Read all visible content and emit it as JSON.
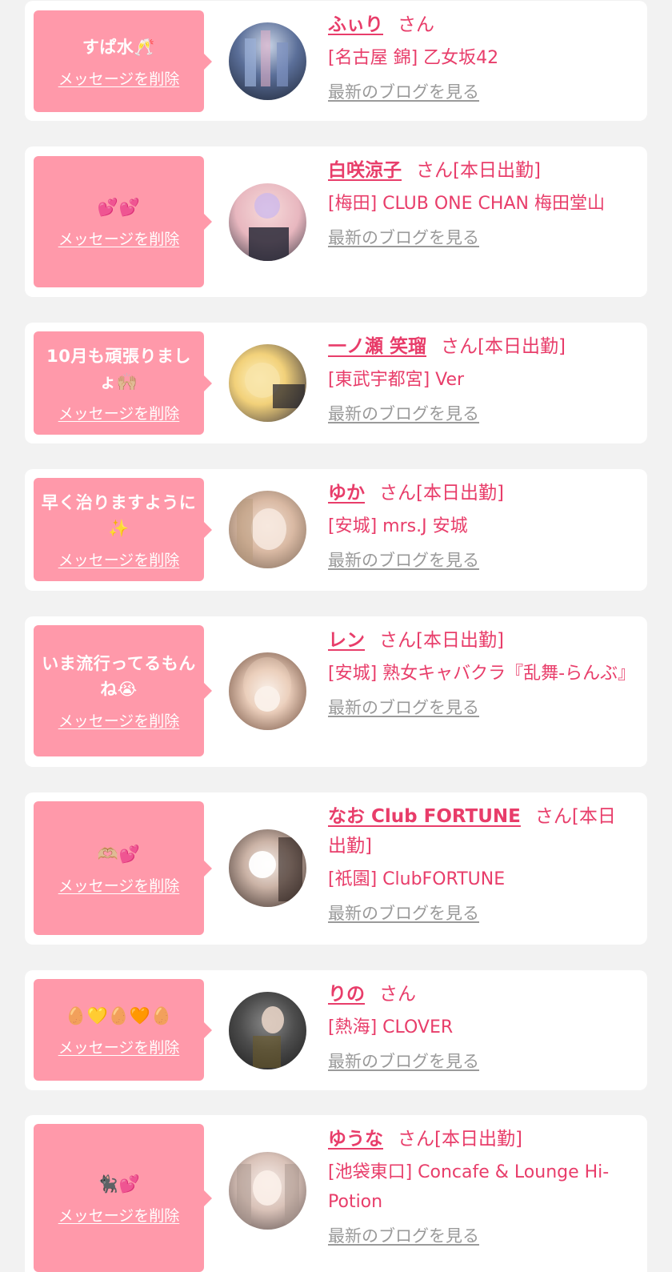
{
  "ui": {
    "delete_label": "メッセージを削除",
    "blog_label": "最新のブログを見る",
    "honorific": "さん",
    "working_today": "[本日出勤]"
  },
  "colors": {
    "page_bg": "#f2f2f2",
    "card_bg": "#ffffff",
    "bubble_bg": "#ff99aa",
    "name_color": "#e83d6a",
    "link_gray": "#9a9a9a"
  },
  "items": [
    {
      "message": "すぱ水🥂",
      "name": "ふぃり",
      "suffix": "さん",
      "shop": "[名古屋 錦] 乙女坂42",
      "avatar_icon": "avatar-photo"
    },
    {
      "message": "💕💕",
      "name": "白咲涼子",
      "suffix": "さん[本日出勤]",
      "shop": "[梅田] CLUB ONE CHAN 梅田堂山",
      "avatar_icon": "avatar-photo"
    },
    {
      "message": "10月も頑張りましょ🙌🏼",
      "name": "一ノ瀬 笑瑠",
      "suffix": "さん[本日出勤]",
      "shop": "[東武宇都宮] Ver",
      "avatar_icon": "avatar-photo"
    },
    {
      "message": "早く治りますように✨",
      "name": "ゆか",
      "suffix": "さん[本日出勤]",
      "shop": "[安城] mrs.J 安城",
      "avatar_icon": "avatar-photo"
    },
    {
      "message": "いま流行ってるもんね😭",
      "name": "レン",
      "suffix": "さん[本日出勤]",
      "shop": "[安城] 熟女キャバクラ『乱舞-らんぶ』",
      "avatar_icon": "avatar-photo"
    },
    {
      "message": "🫶🏼💕",
      "name": "なお Club FORTUNE",
      "suffix": "さん[本日出勤]",
      "shop": "[祇園] ClubFORTUNE",
      "avatar_icon": "avatar-photo"
    },
    {
      "message": "🥚💛🥚🧡🥚",
      "name": "りの",
      "suffix": "さん",
      "shop": "[熱海] CLOVER",
      "avatar_icon": "avatar-photo"
    },
    {
      "message": "🐈‍⬛💕",
      "name": "ゆうな",
      "suffix": "さん[本日出勤]",
      "shop": "[池袋東口] Concafe & Lounge Hi-Potion",
      "avatar_icon": "avatar-photo"
    }
  ]
}
